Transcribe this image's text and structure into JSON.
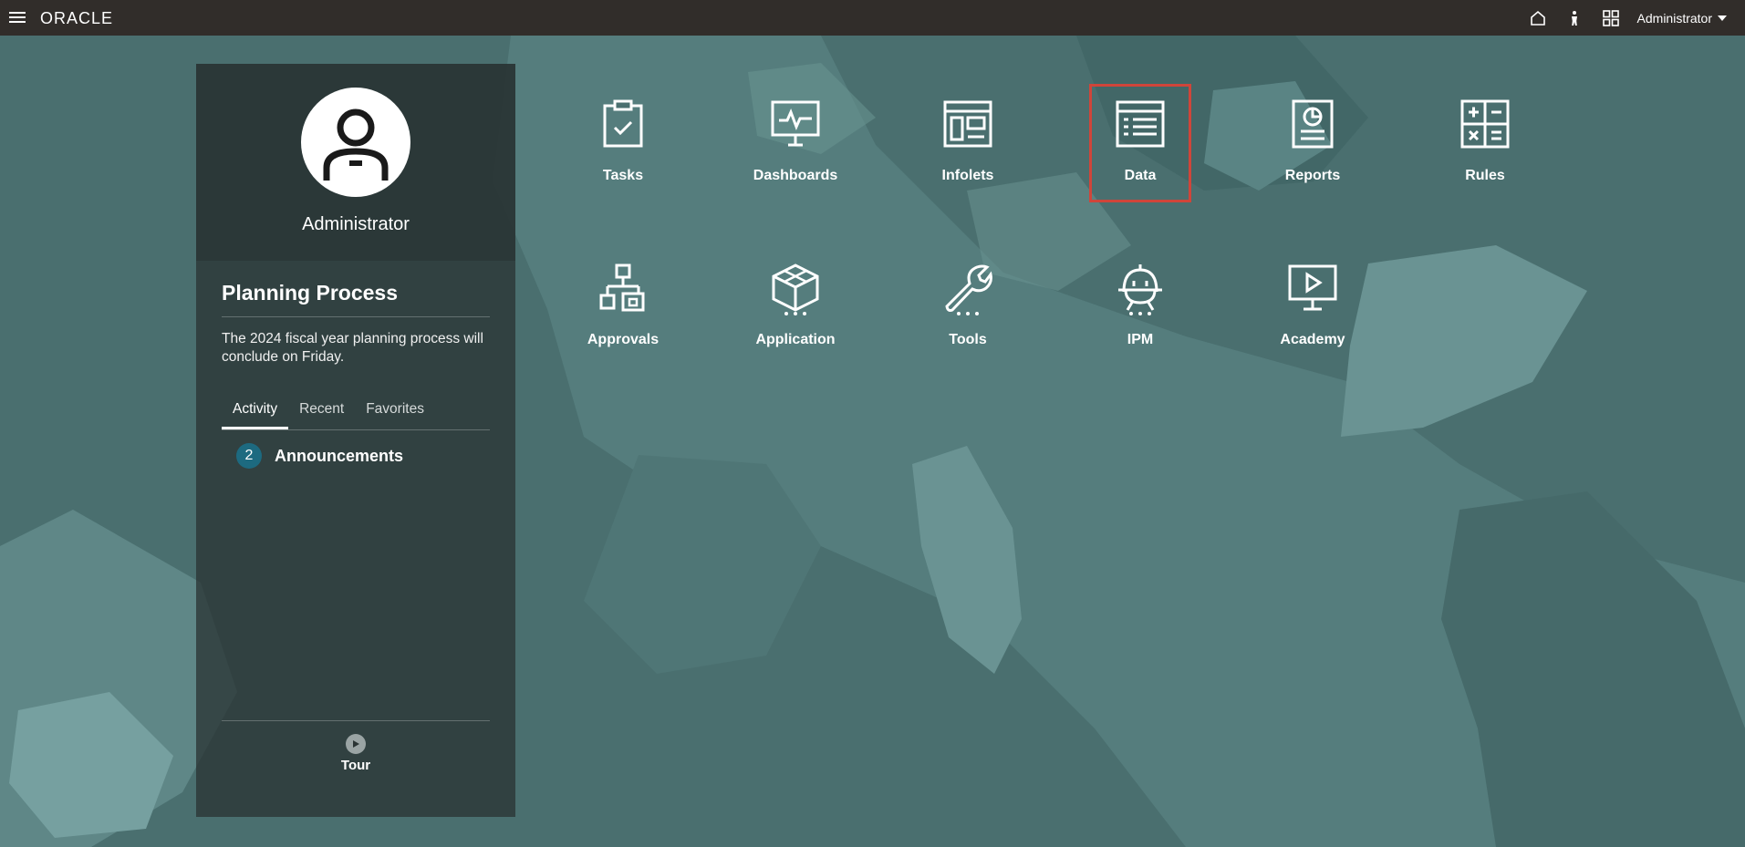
{
  "topbar": {
    "logo": "ORACLE",
    "user_label": "Administrator",
    "icons": [
      "menu-icon",
      "home-icon",
      "accessibility-icon",
      "navigator-icon"
    ]
  },
  "panel": {
    "user_name": "Administrator",
    "process_title": "Planning Process",
    "process_message": "The 2024 fiscal year planning process will conclude on Friday.",
    "tabs": [
      {
        "label": "Activity",
        "active": true
      },
      {
        "label": "Recent",
        "active": false
      },
      {
        "label": "Favorites",
        "active": false
      }
    ],
    "announcements": {
      "count": "2",
      "label": "Announcements"
    },
    "tour_label": "Tour"
  },
  "tiles": [
    {
      "label": "Tasks",
      "icon": "clipboard-check-icon"
    },
    {
      "label": "Dashboards",
      "icon": "monitor-chart-icon"
    },
    {
      "label": "Infolets",
      "icon": "infolet-icon"
    },
    {
      "label": "Data",
      "icon": "data-grid-icon",
      "selected": true
    },
    {
      "label": "Reports",
      "icon": "report-icon"
    },
    {
      "label": "Rules",
      "icon": "calculator-icon"
    },
    {
      "label": "Approvals",
      "icon": "hierarchy-icon"
    },
    {
      "label": "Application",
      "icon": "cube-icon"
    },
    {
      "label": "Tools",
      "icon": "wrench-icon"
    },
    {
      "label": "IPM",
      "icon": "robot-icon"
    },
    {
      "label": "Academy",
      "icon": "video-monitor-icon"
    }
  ],
  "colors": {
    "topbar": "#312d2a",
    "background": "#4a6f6f",
    "selection": "#d0453a",
    "badge": "#1d6a80"
  }
}
